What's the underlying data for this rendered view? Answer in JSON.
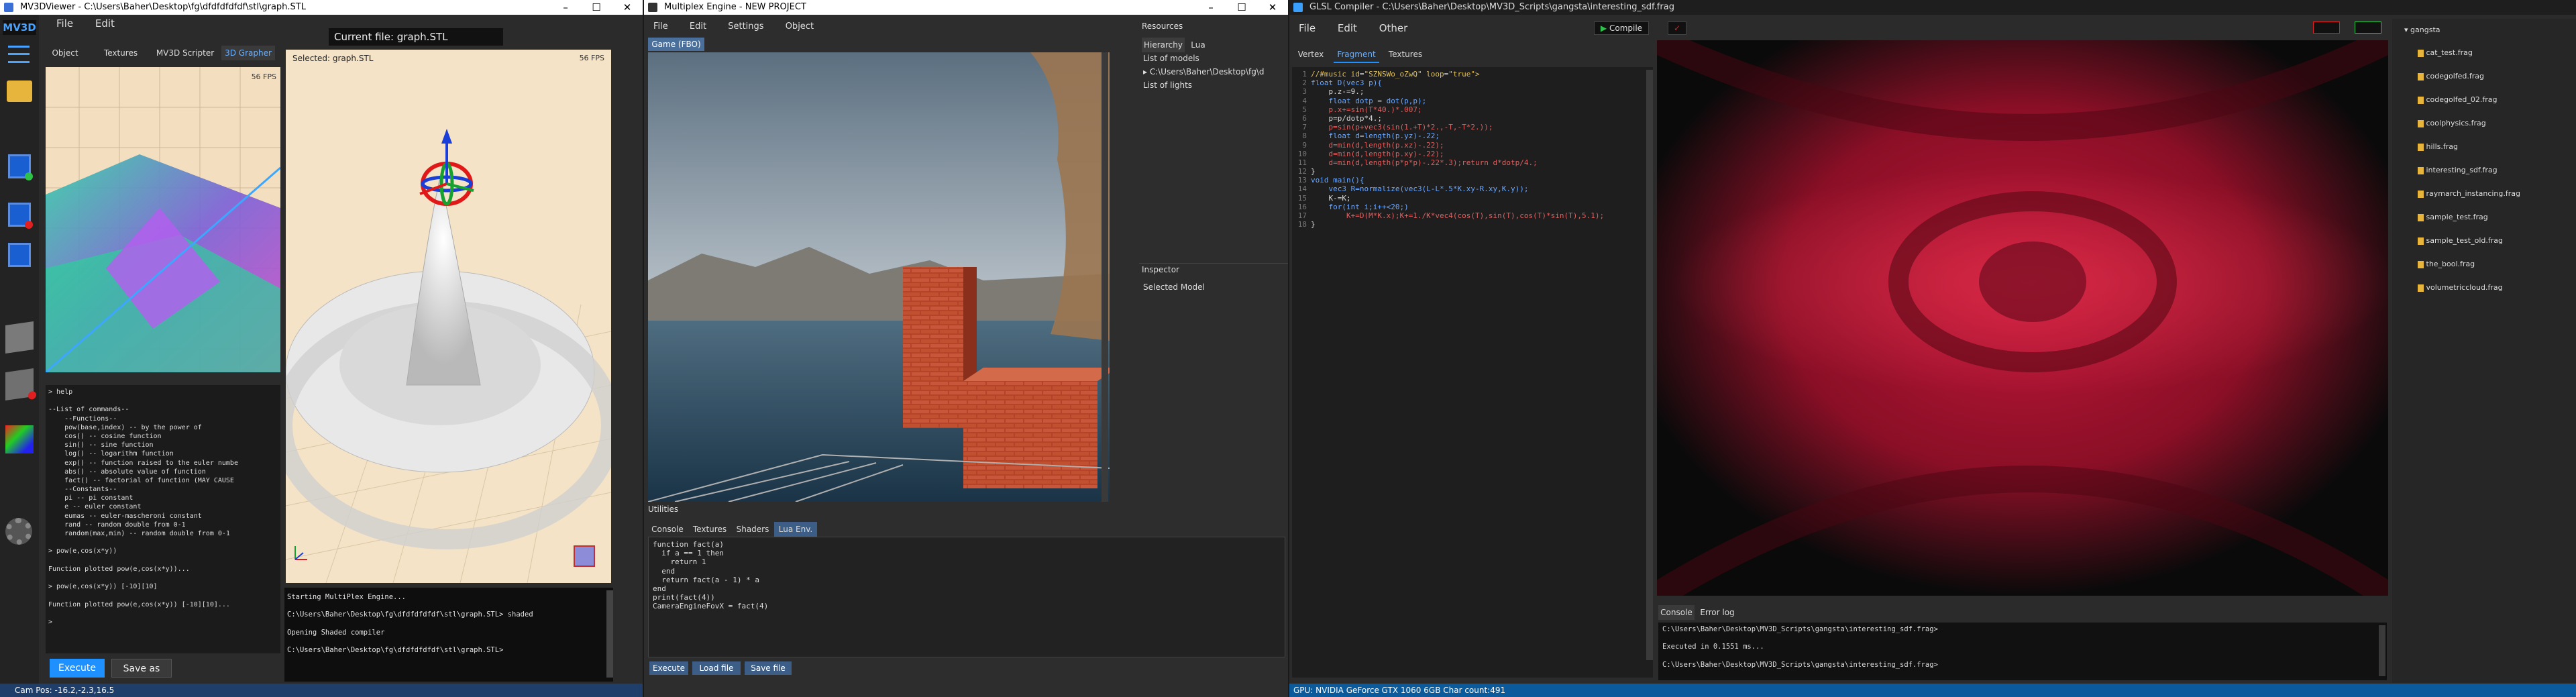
{
  "win1": {
    "title": "MV3DViewer - C:\\Users\\Baher\\Desktop\\fg\\dfdfdfdfdf\\stl\\graph.STL",
    "menu": [
      "File",
      "Edit"
    ],
    "current_file": "Current file: graph.STL",
    "logo": "MV3D",
    "tabs": [
      "Object",
      "Textures",
      "MV3D Scripter",
      "3D Grapher"
    ],
    "fps_left": "56 FPS",
    "fps_right": "56 FPS",
    "selected": "Selected: graph.STL",
    "console_lines": [
      "> help",
      "",
      "--List of commands--",
      "    --Functions--",
      "    pow(base,index) -- by the power of",
      "    cos() -- cosine function",
      "    sin() -- sine function",
      "    log() -- logarithm function",
      "    exp() -- function raised to the euler numbe",
      "    abs() -- absolute value of function",
      "    fact() -- factorial of function (MAY CAUSE",
      "    --Constants--",
      "    pi -- pi constant",
      "    e -- euler constant",
      "    eumas -- euler-mascheroni constant",
      "    rand -- random double from 0-1",
      "    random(max,min) -- random double from 0-1",
      "",
      "> pow(e,cos(x*y))",
      "",
      "Function plotted pow(e,cos(x*y))...",
      "",
      "> pow(e,cos(x*y)) [-10][10]",
      "",
      "Function plotted pow(e,cos(x*y)) [-10][10]...",
      "",
      ">"
    ],
    "execute": "Execute",
    "save_as": "Save as",
    "viewer_console": [
      "Starting MultiPlex Engine...",
      "",
      "C:\\Users\\Baher\\Desktop\\fg\\dfdfdfdfdf\\stl\\graph.STL> shaded",
      "",
      "Opening Shaded compiler",
      "",
      "C:\\Users\\Baher\\Desktop\\fg\\dfdfdfdfdf\\stl\\graph.STL>"
    ],
    "cam_pos": "Cam Pos: -16.2,-2.3,16.5"
  },
  "win2": {
    "title": "Multiplex Engine - NEW PROJECT",
    "menu": [
      "File",
      "Edit",
      "Settings",
      "Object"
    ],
    "game_tab": "Game (FBO)",
    "resources": "Resources",
    "res_tabs": [
      "Hierarchy",
      "Lua"
    ],
    "list_models": "List of models",
    "model_item": "C:\\Users\\Baher\\Desktop\\fg\\d",
    "list_lights": "List of lights",
    "inspector": "Inspector",
    "selected_model": "Selected Model",
    "utilities": "Utilities",
    "util_tabs": [
      "Console",
      "Textures",
      "Shaders",
      "Lua Env."
    ],
    "lua_code": [
      "function fact(a)",
      "  if a == 1 then",
      "    return 1",
      "  end",
      "  return fact(a - 1) * a",
      "end",
      "print(fact(4))",
      "CameraEngineFovX = fact(4)"
    ],
    "buttons": [
      "Execute",
      "Load file",
      "Save file"
    ]
  },
  "win3": {
    "title": "GLSL Compiler - C:\\Users\\Baher\\Desktop\\MV3D_Scripts\\gangsta\\interesting_sdf.frag",
    "menu": [
      "File",
      "Edit",
      "Other"
    ],
    "compile": "Compile",
    "shader_tabs": [
      "Vertex",
      "Fragment",
      "Textures"
    ],
    "code_lines": [
      "//#music id=\"SZNSWo_oZwQ\" loop=\"true\">",
      "float D(vec3 p){",
      "    p.z-=9.;",
      "    float dotp = dot(p,p);",
      "    p.x+=sin(T*40.)*.007;",
      "    p=p/dotp*4.;",
      "    p=sin(p+vec3(sin(1.+T)*2.,-T,-T*2.));",
      "    float d=length(p.yz)-.22;",
      "    d=min(d,length(p.xz)-.22);",
      "    d=min(d,length(p.xy)-.22);",
      "    d=min(d,length(p*p*p)-.22*.3);return d*dotp/4.;",
      "}",
      "void main(){",
      "    vec3 R=normalize(vec3(L-L*.5*K.xy-R.xy,K.y));",
      "    K-=K;",
      "    for(int i;i++<20;)",
      "        K+=D(M*K.x);K+=1./K*vec4(cos(T),sin(T),cos(T)*sin(T),5.1);",
      "}"
    ],
    "console_tabs": [
      "Console",
      "Error log"
    ],
    "console_lines": [
      "C:\\Users\\Baher\\Desktop\\MV3D_Scripts\\gangsta\\interesting_sdf.frag>",
      "",
      "Executed in 0.1551 ms...",
      "",
      "C:\\Users\\Baher\\Desktop\\MV3D_Scripts\\gangsta\\interesting_sdf.frag>"
    ],
    "status": "GPU: NVIDIA GeForce GTX 1060 6GB   Char count:491",
    "folder": "gangsta",
    "files": [
      "cat_test.frag",
      "codegolfed.frag",
      "codegolfed_02.frag",
      "coolphysics.frag",
      "hills.frag",
      "interesting_sdf.frag",
      "raymarch_instancing.frag",
      "sample_test.frag",
      "sample_test_old.frag",
      "the_bool.frag",
      "volumetriccloud.frag"
    ]
  },
  "colors": {
    "accent": "#1e90ff",
    "selection": "#0078d7",
    "gpu_bar": "#0a5a9c"
  }
}
